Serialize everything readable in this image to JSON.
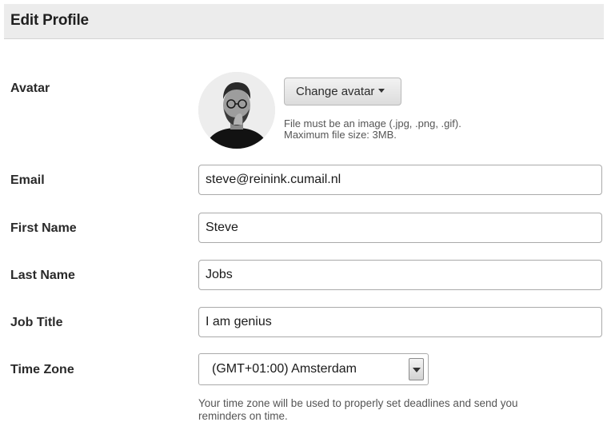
{
  "header": {
    "title": "Edit Profile"
  },
  "avatar": {
    "label": "Avatar",
    "button_label": "Change avatar",
    "help_line1": "File must be an image (.jpg, .png, .gif).",
    "help_line2": "Maximum file size: 3MB."
  },
  "email": {
    "label": "Email",
    "value": "steve@reinink.cumail.nl"
  },
  "first_name": {
    "label": "First Name",
    "value": "Steve"
  },
  "last_name": {
    "label": "Last Name",
    "value": "Jobs"
  },
  "job_title": {
    "label": "Job Title",
    "value": "I am genius"
  },
  "time_zone": {
    "label": "Time Zone",
    "selected": "(GMT+01:00) Amsterdam",
    "help_line1": "Your time zone will be used to properly set deadlines and send you",
    "help_line2": "reminders on time."
  },
  "icons": {
    "button_caret": "caret-down-icon",
    "select_arrow": "select-arrow-icon"
  }
}
